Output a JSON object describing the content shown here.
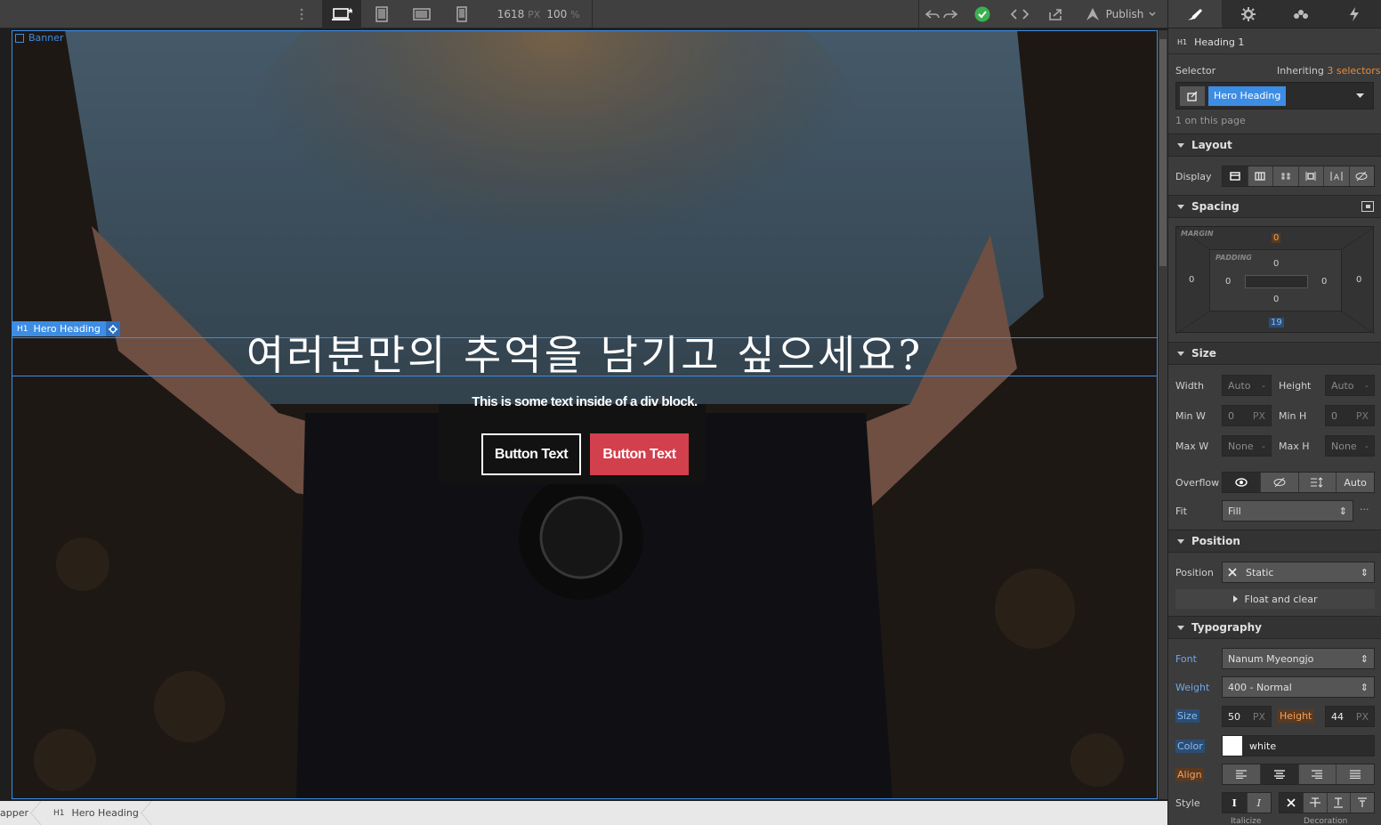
{
  "topbar": {
    "width_value": "1618",
    "width_unit": "PX",
    "zoom_value": "100",
    "zoom_unit": "%",
    "publish_label": "Publish"
  },
  "canvas": {
    "banner_label": "Banner",
    "hero_tag_prefix": "H1",
    "hero_tag_label": "Hero Heading",
    "hero_heading": "여러분만의 추억을 남기고 싶으세요?",
    "hero_text": "This is some text inside of a div block.",
    "button1": "Button Text",
    "button2": "Button Text"
  },
  "breadcrumb": {
    "item1": "apper",
    "item2_prefix": "H1",
    "item2": "Hero Heading"
  },
  "panel": {
    "element_prefix": "H1",
    "element_label": "Heading 1",
    "selector_label": "Selector",
    "inheriting_label": "Inheriting",
    "inheriting_count": "3 selectors",
    "selector_token": "Hero Heading",
    "on_page": "1 on this page",
    "layout": {
      "title": "Layout",
      "display_label": "Display"
    },
    "spacing": {
      "title": "Spacing",
      "margin_label": "MARGIN",
      "padding_label": "PADDING",
      "margin_top": "0",
      "margin_left": "0",
      "margin_right": "0",
      "margin_bottom": "19",
      "padding_top": "0",
      "padding_left": "0",
      "padding_right": "0",
      "padding_bottom": "0"
    },
    "size": {
      "title": "Size",
      "width_label": "Width",
      "width_value": "Auto",
      "width_unit": "-",
      "height_label": "Height",
      "height_value": "Auto",
      "height_unit": "-",
      "minw_label": "Min W",
      "minw_value": "0",
      "minw_unit": "PX",
      "minh_label": "Min H",
      "minh_value": "0",
      "minh_unit": "PX",
      "maxw_label": "Max W",
      "maxw_value": "None",
      "maxw_unit": "-",
      "maxh_label": "Max H",
      "maxh_value": "None",
      "maxh_unit": "-",
      "overflow_label": "Overflow",
      "overflow_auto": "Auto",
      "fit_label": "Fit",
      "fit_value": "Fill",
      "fit_more": "···"
    },
    "position": {
      "title": "Position",
      "position_label": "Position",
      "position_value": "Static",
      "float_label": "Float and clear"
    },
    "typography": {
      "title": "Typography",
      "font_label": "Font",
      "font_value": "Nanum Myeongjo",
      "weight_label": "Weight",
      "weight_value": "400 - Normal",
      "size_label": "Size",
      "size_value": "50",
      "size_unit": "PX",
      "height_label": "Height",
      "height_value": "44",
      "height_unit": "PX",
      "color_label": "Color",
      "color_value": "white",
      "align_label": "Align",
      "style_label": "Style",
      "italicize_label": "Italicize",
      "decoration_label": "Decoration"
    }
  },
  "colors": {
    "accent": "#3d8de4",
    "button_red": "#d23f4d",
    "selector_token": "#3d8de4"
  }
}
